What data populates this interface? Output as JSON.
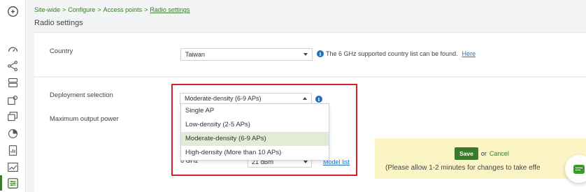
{
  "breadcrumb": {
    "items": [
      "Site-wide",
      "Configure",
      "Access points",
      "Radio settings"
    ],
    "separator": ">"
  },
  "page": {
    "title": "Radio settings"
  },
  "country": {
    "label": "Country",
    "value": "Taiwan",
    "note": "The 6 GHz supported country list can be found.",
    "link": "Here"
  },
  "deployment": {
    "label": "Deployment selection",
    "value": "Moderate-density (6-9 APs)",
    "options": [
      "Single AP",
      "Low-density (2-5 APs)",
      "Moderate-density (6-9 APs)",
      "High-density (More than 10 APs)"
    ],
    "selected_index": 2
  },
  "output_power": {
    "label": "Maximum output power",
    "band": "6 GHz",
    "value": "21 dBm",
    "model_link": "Model list"
  },
  "save_panel": {
    "save_label": "Save",
    "or_text": "or",
    "cancel_label": "Cancel",
    "note": "(Please allow 1-2 minutes for changes to take effe"
  },
  "sidebar": {
    "icons": [
      "dashboard-icon",
      "topology-icon",
      "devices-icon",
      "clients-icon",
      "monitor-icon",
      "pie-icon",
      "report-icon",
      "chart-icon",
      "configure-icon"
    ]
  },
  "colors": {
    "accent": "#3b7a2a",
    "link": "#1f6fb9",
    "highlight": "#d6202a",
    "save_panel_bg": "#fbf5c6"
  }
}
